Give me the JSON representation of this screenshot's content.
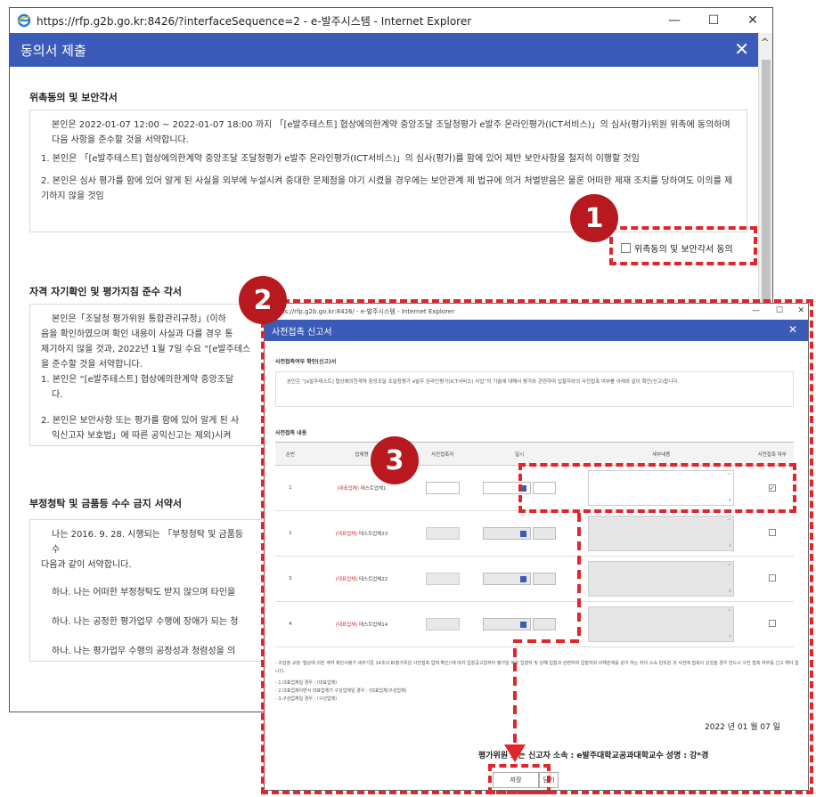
{
  "window1": {
    "titlebar": "https://rfp.g2b.go.kr:8426/?interfaceSequence=2 - e-발주시스템 - Internet Explorer",
    "controls": {
      "minimize": "—",
      "maximize": "☐",
      "close": "✕"
    },
    "dialog_title": "동의서 제출",
    "close_glyph": "✕",
    "scroll_up": "^",
    "section1": {
      "title": "위촉동의 및 보안각서",
      "p1": "본인은 2022-01-07 12:00 ~ 2022-01-07 18:00 까지 「[e발주테스트] 협상에의한계약 중앙조달 조달청평가 e발주 온라인평가(ICT서비스)」의 심사(평가)위원 위촉에 동의하며 다음 사항을 준수할 것을 서약합니다.",
      "i1": "1. 본인은 「[e발주테스트] 협상에의한계약 중앙조달 조달청평가 e발주 온라인평가(ICT서비스)」의 심사(평가)를 함에 있어 제반 보안사항을 철저히 이행할 것임",
      "i2": "2. 본인은 심사 평가를 함에 있어 알게 된 사실을 외부에 누설시켜 중대한 문제점을 야기 시켰을 경우에는 보안관계 제 법규에 의거 처벌받음은 물론 어떠한 제재 조치를 당하여도 이의를 제기하지 않을 것임",
      "agree_label": "위촉동의 및 보안각서 동의"
    },
    "section2": {
      "title": "자격 자기확인 및 평가지침 준수 각서",
      "p1": "본인은「조달청 평가위원 통합관리규정」(이하",
      "p2": "음을 확인하였으며 확인 내용이 사실과 다를 경우 통",
      "p3": "제기하지 않을 것과, 2022년 1월 7일 수요 “[e발주테스",
      "p4": "을 준수할 것을 서약합니다.",
      "i1": "1. 본인은 “[e발주테스트] 협상에의한계약 중앙조달",
      "i1b": "다.",
      "i2": "2. 본인은 보안사항 또는 평가를 함에 있어 알게 된 사",
      "i2b": "익신고자 보호법」에 따른 공익신고는 제외)시켜"
    },
    "section3": {
      "title": "부정청탁 및 금품등 수수 금지 서약서",
      "p1": "나는 2016. 9. 28. 시행되는 「부정청탁 및 금품등 수",
      "p2": "다음과 같이 서약합니다.",
      "h1": "하나. 나는 어떠한 부정청탁도 받지 않으며 타인을",
      "h2": "하나. 나는 공정한 평가업무 수행에 장애가 되는 청",
      "h3": "하나. 나는 평가업무 수행의 공정성과 청렴성을 의"
    }
  },
  "window2": {
    "titlebar": "https://rfp.g2b.go.kr:8426/ - e-발주시스템 - Internet Explorer",
    "controls": {
      "minimize": "—",
      "maximize": "☐",
      "close": "✕"
    },
    "dialog_title": "사전접촉 신고서",
    "close_glyph": "✕",
    "confirm_title": "사전접촉여부 확인(신고)서",
    "confirm_text": "본인은 “[e발주테스트] 협상에의한계약 중앙조달 조달청평가 e발주 온라인평가(ICT서비스) 사업”의 기술에 대해서 평가와 관련하여 입찰자와의 사전접촉 여부를 아래와 같이 확인(신고)합니다.",
    "table_title": "사전접촉 내용",
    "columns": [
      "순번",
      "업체명",
      "사전접촉자",
      "일시",
      "세부내용",
      "사전접촉 여부"
    ],
    "rows": [
      {
        "no": "1",
        "tag": "(대표업체)",
        "name": "테스트업체1",
        "checked": "✓"
      },
      {
        "no": "2",
        "tag": "(대표업체)",
        "name": "테스트업체23",
        "checked": ""
      },
      {
        "no": "3",
        "tag": "(대표업체)",
        "name": "테스트업체22",
        "checked": ""
      },
      {
        "no": "4",
        "tag": "(대표업체)",
        "name": "테스트업체14",
        "checked": ""
      }
    ],
    "scroll_up": "^",
    "scroll_down": "v",
    "note_main": "- 조달청 규정 '협상에 의한 계약 제안서평가 세부기준 14조의 8(평가위원 사전접촉 업체 확인)'에 따라 입찰공고일부터 평가일 까지 입찰자 및 당해 입찰과 관련하여 입찰자와 이해관계를 같이 하는 자의 소속 임직원 과 사전에 접촉이 있었을 경우 반드시 사전 접촉 여부를 신고 해야 합니다.",
    "note1": "- 1.대표업체일 경우 : (대표업체)",
    "note2": "- 2.대표업체이면서 대표업체가 구성업체일 경우 : (대표업체/구성업체)",
    "note3": "- 3.구성업체일 경우 : (구성업체)",
    "date_line": "2022 년   01 월   07 일",
    "sign_line": "평가위원 또는 신고자 소속 : e발주대학교공과대학교수   성명 : 강*경",
    "save": "저장",
    "close": "닫기"
  },
  "badges": [
    "1",
    "2",
    "3"
  ]
}
